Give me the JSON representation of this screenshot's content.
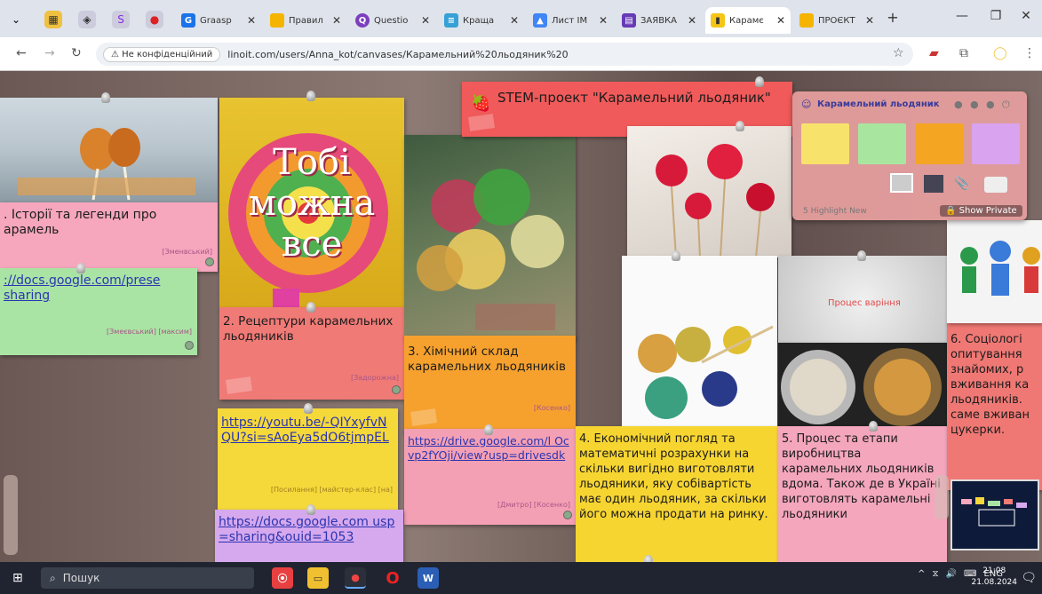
{
  "browser": {
    "tabs": [
      {
        "label": "Graasp",
        "icon_color": "#1a73e8"
      },
      {
        "label": "Правил",
        "icon_color": "#f4b400"
      },
      {
        "label": "Questio",
        "icon_color": "#7b3fbf"
      },
      {
        "label": "Краща",
        "icon_color": "#35a1d6"
      },
      {
        "label": "Лист ІМ",
        "icon_color": "#4285f4"
      },
      {
        "label": "ЗАЯВКА",
        "icon_color": "#673ab7"
      },
      {
        "label": "Карамє",
        "icon_color": "#f5c518"
      },
      {
        "label": "ПРОЄКТ",
        "icon_color": "#f4b400"
      }
    ],
    "new_tab": "+",
    "security_label": "Не конфіденційний",
    "url": "linoit.com/users/Anna_kot/canvases/Карамельний%20льодяник%20"
  },
  "canvas": {
    "title_note": "STEM-проект \"Карамельний льодяник\"",
    "notes": {
      "n1_text": ". Історії та легенди про арамель",
      "n1_tags": "[Зменвський]",
      "n2_link": "://docs.google.com/prese sharing",
      "n2_tags": "[Змеєвський] [максим]",
      "n3_text": "2. Рецептури карамельних льодяників",
      "n3_tags": "[Задорожна]",
      "n4_text": "3. Хімічний склад карамельних льодяників",
      "n4_tags": "[Косенко]",
      "n5_link": "https://youtu.be/-QIYxyfvNQU?si=sAoEya5dO6tjmpEL",
      "n5_tags": "[Посилання] [майстер-клас] [на]",
      "n6_link": "https://drive.google.com/l Ocvp2fYOji/view?usp=drivesdk",
      "n6_tags": "[Дмитро] [Косенко]",
      "n7_link": "https://docs.google.com usp=sharing&ouid=1053",
      "n8_text": "4. Економічний погляд та математичні розрахунки на скільки вигідно виготовляти льодяники, яку собівартість має один льодяник, за скільки його можна продати на ринку.",
      "n9_text": "5. Процес та етапи виробництва карамельних льодяників вдома. Також де в Україні виготовлять карамельні льодяники",
      "n10_text": "6. Соціологі опитування знайомих, р вживання ка льодяників. саме вживан цукерки."
    },
    "photo_lollipop_text": "Тобі можна все",
    "photo_process_text": "Процес варіння"
  },
  "panel": {
    "title": "Карамельний льодяник",
    "swatches": [
      "#f7e36b",
      "#a8e6a0",
      "#f4a623",
      "#d9a3f0"
    ],
    "highlight_label": "5 Highlight New",
    "show_private": "Show Private"
  },
  "taskbar": {
    "search_placeholder": "Пошук",
    "lang": "ENG",
    "time": "21:08",
    "date": "21.08.2024"
  }
}
